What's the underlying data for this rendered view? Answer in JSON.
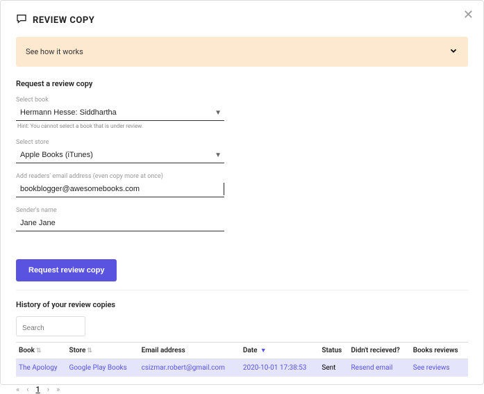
{
  "header": {
    "title": "REVIEW COPY"
  },
  "banner": {
    "text": "See how it works"
  },
  "form": {
    "title": "Request a review copy",
    "book": {
      "label": "Select book",
      "value": "Hermann Hesse: Siddhartha",
      "hint": "Hint: You cannot select a book that is under review."
    },
    "store": {
      "label": "Select store",
      "value": "Apple Books (iTunes)"
    },
    "email": {
      "label": "Add readers' email address (even copy more at once)",
      "value": "bookblogger@awesomebooks.com"
    },
    "sender": {
      "label": "Sender's name",
      "value": "Jane Jane"
    },
    "submit_label": "Request review copy"
  },
  "history": {
    "title": "History of your review copies",
    "search_placeholder": "Search",
    "columns": {
      "book": "Book",
      "store": "Store",
      "email": "Email address",
      "date": "Date",
      "status": "Status",
      "didnt": "Didn't recieved?",
      "reviews": "Books reviews"
    },
    "rows": [
      {
        "book": "The Apology",
        "store": "Google Play Books",
        "email": "csizmar.robert@gmail.com",
        "date": "2020-10-01 17:38:53",
        "status": "Sent",
        "didnt": "Resend email",
        "reviews": "See reviews"
      }
    ],
    "pagination": {
      "current": "1"
    }
  }
}
